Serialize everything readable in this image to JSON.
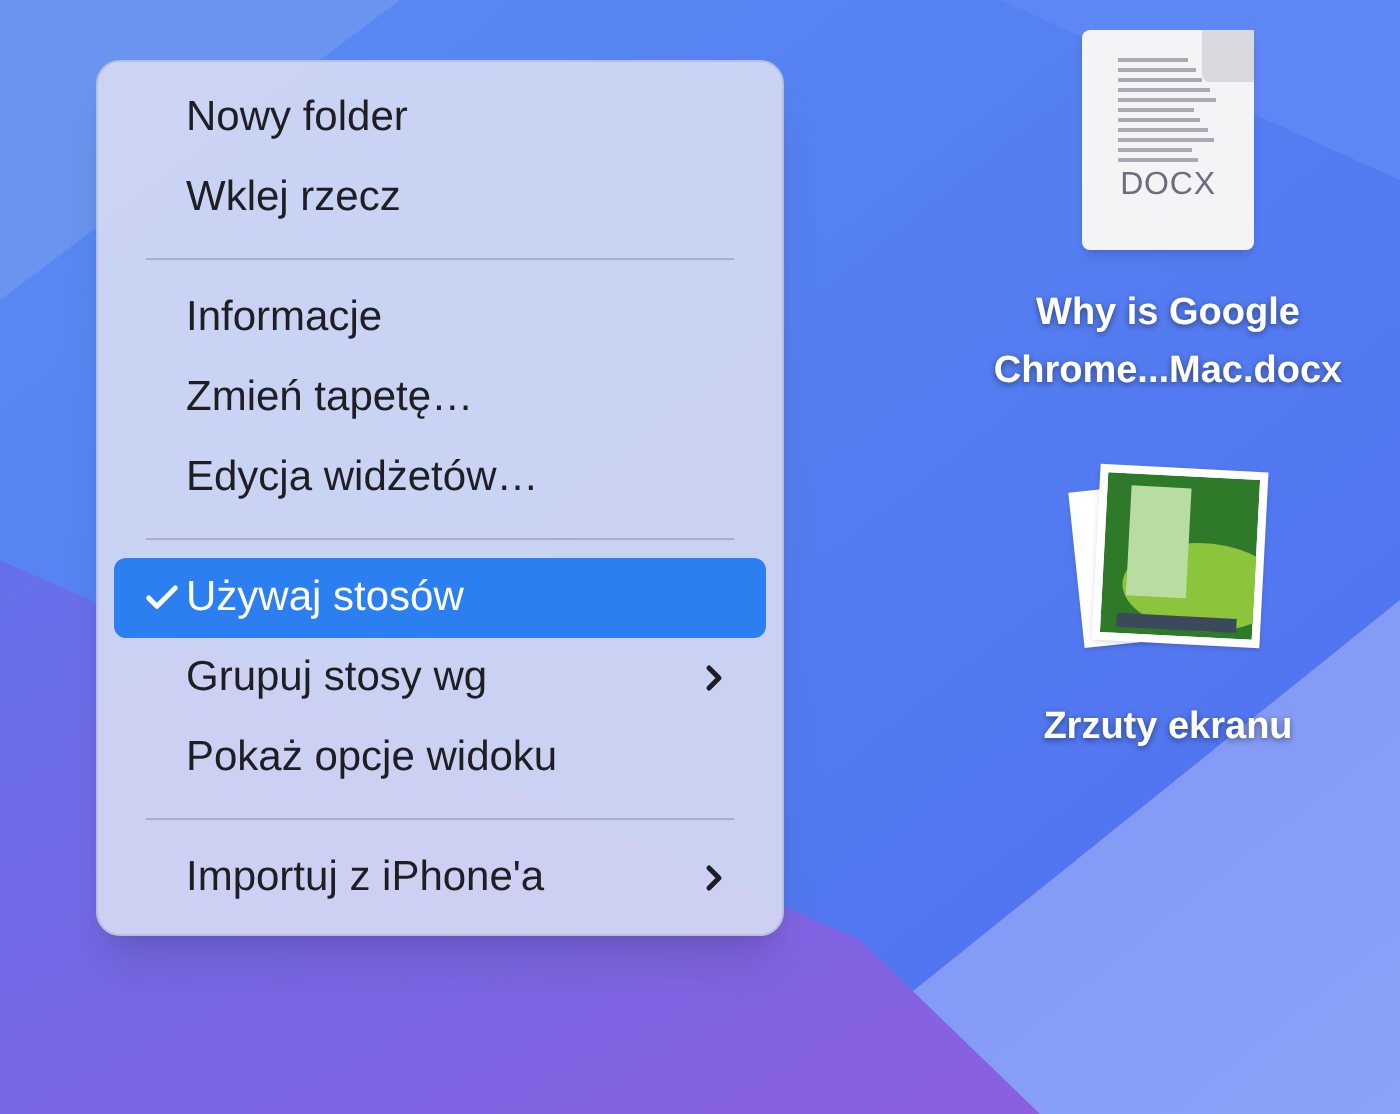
{
  "context_menu": {
    "groups": [
      {
        "items": [
          {
            "label": "Nowy folder",
            "checked": false,
            "selected": false,
            "submenu": false
          },
          {
            "label": "Wklej rzecz",
            "checked": false,
            "selected": false,
            "submenu": false
          }
        ]
      },
      {
        "items": [
          {
            "label": "Informacje",
            "checked": false,
            "selected": false,
            "submenu": false
          },
          {
            "label": "Zmień tapetę…",
            "checked": false,
            "selected": false,
            "submenu": false
          },
          {
            "label": "Edycja widżetów…",
            "checked": false,
            "selected": false,
            "submenu": false
          }
        ]
      },
      {
        "items": [
          {
            "label": "Używaj stosów",
            "checked": true,
            "selected": true,
            "submenu": false
          },
          {
            "label": "Grupuj stosy wg",
            "checked": false,
            "selected": false,
            "submenu": true
          },
          {
            "label": "Pokaż opcje widoku",
            "checked": false,
            "selected": false,
            "submenu": false
          }
        ]
      },
      {
        "items": [
          {
            "label": "Importuj z iPhone'a",
            "checked": false,
            "selected": false,
            "submenu": true
          }
        ]
      }
    ]
  },
  "desktop_icons": [
    {
      "kind": "document",
      "badge": "DOCX",
      "label_lines": [
        "Why is Google",
        "Chrome...Mac.docx"
      ]
    },
    {
      "kind": "stack",
      "label_lines": [
        "Zrzuty ekranu"
      ]
    }
  ]
}
